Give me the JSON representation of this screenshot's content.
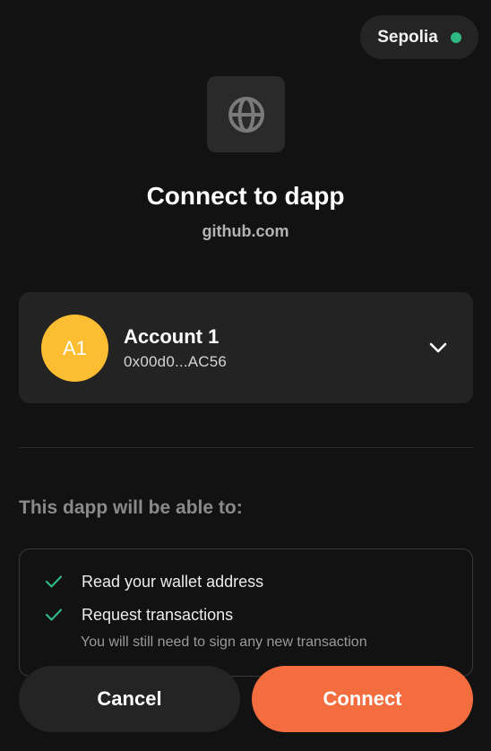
{
  "network": {
    "label": "Sepolia",
    "status_color": "#2fb883"
  },
  "site": {
    "icon": "globe-icon",
    "title": "Connect to dapp",
    "domain": "github.com"
  },
  "account": {
    "avatar_initials": "A1",
    "avatar_color": "#fdbd32",
    "name": "Account 1",
    "address": "0x00d0...AC56",
    "expand_icon": "chevron-down-icon"
  },
  "permissions": {
    "heading": "This dapp will be able to:",
    "items": [
      {
        "label": "Read your wallet address",
        "icon": "check-icon"
      },
      {
        "label": "Request transactions",
        "icon": "check-icon"
      }
    ],
    "note": "You will still need to sign any new transaction"
  },
  "actions": {
    "cancel_label": "Cancel",
    "connect_label": "Connect",
    "connect_color": "#f36d3f"
  }
}
